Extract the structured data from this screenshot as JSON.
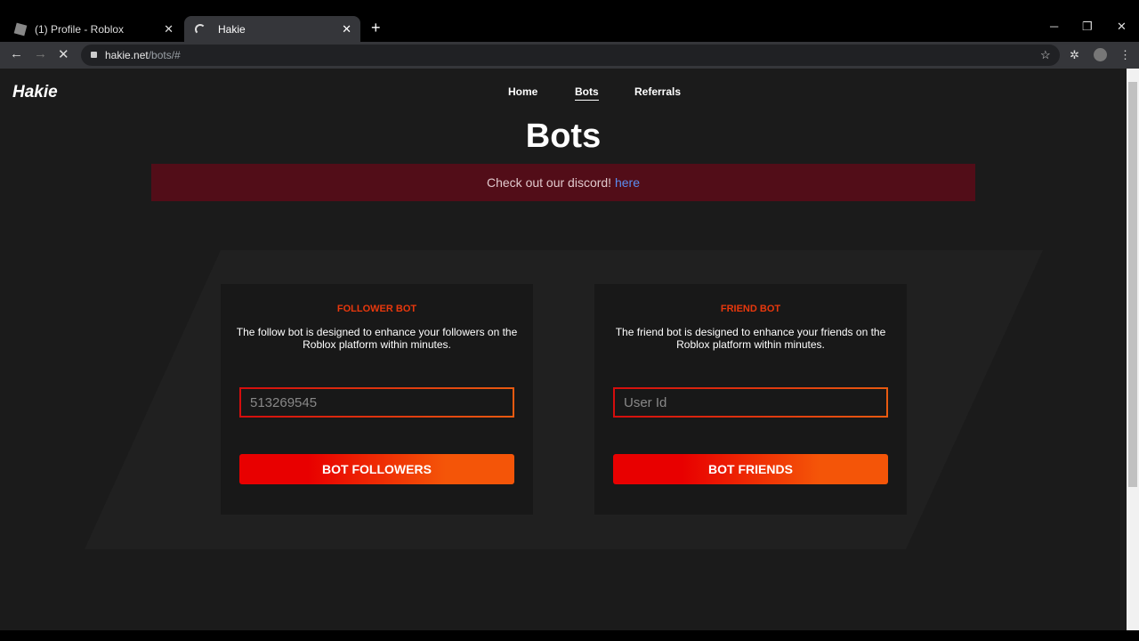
{
  "browser": {
    "tabs": [
      {
        "title": "(1) Profile - Roblox"
      },
      {
        "title": "Hakie"
      }
    ],
    "url_host": "hakie.net",
    "url_path": "/bots/#",
    "new_tab": "+",
    "close": "✕"
  },
  "site": {
    "logo": "Hakie",
    "nav": [
      {
        "label": "Home"
      },
      {
        "label": "Bots"
      },
      {
        "label": "Referrals"
      }
    ],
    "title": "Bots",
    "banner": {
      "text": "Check out our discord! ",
      "link": "here"
    }
  },
  "cards": [
    {
      "title": "FOLLOWER BOT",
      "description": "The follow bot is designed to enhance your followers on the Roblox platform within minutes.",
      "input_value": "513269545",
      "input_placeholder": "User Id",
      "button": "BOT FOLLOWERS"
    },
    {
      "title": "FRIEND BOT",
      "description": "The friend bot is designed to enhance your friends on the Roblox platform within minutes.",
      "input_value": "",
      "input_placeholder": "User Id",
      "button": "BOT FRIENDS"
    }
  ]
}
